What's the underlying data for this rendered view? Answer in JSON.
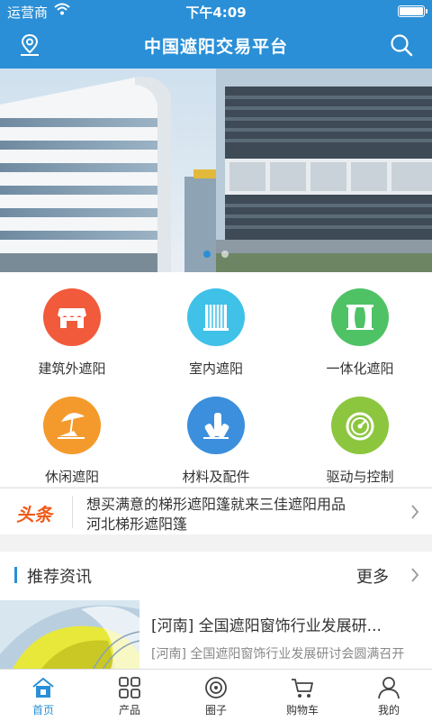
{
  "status_bar": {
    "carrier": "运营商",
    "time": "下午4:09"
  },
  "nav": {
    "title": "中国遮阳交易平台"
  },
  "categories": [
    {
      "label": "建筑外遮阳",
      "color": "#f15a3b",
      "icon": "storefront-icon"
    },
    {
      "label": "室内遮阳",
      "color": "#3fc1e8",
      "icon": "roller-blind-icon"
    },
    {
      "label": "一体化遮阳",
      "color": "#4fc266",
      "icon": "curtain-window-icon"
    },
    {
      "label": "休闲遮阳",
      "color": "#f49a2d",
      "icon": "beach-umbrella-icon"
    },
    {
      "label": "材料及配件",
      "color": "#3b8fdc",
      "icon": "materials-icon"
    },
    {
      "label": "驱动与控制",
      "color": "#8cc63f",
      "icon": "gauge-icon"
    }
  ],
  "headline": {
    "tag": "头条",
    "lines": [
      "想买满意的梯形遮阳篷就来三佳遮阳用品",
      "河北梯形遮阳篷"
    ]
  },
  "news_section": {
    "title": "推荐资讯",
    "more": "更多"
  },
  "news_item": {
    "title": "[河南] 全国遮阳窗饰行业发展研...",
    "summary": "[河南] 全国遮阳窗饰行业发展研讨会圆满召开"
  },
  "tabs": [
    {
      "label": "首页",
      "icon": "home-icon",
      "active": true
    },
    {
      "label": "产品",
      "icon": "grid-icon",
      "active": false
    },
    {
      "label": "圈子",
      "icon": "circle-chat-icon",
      "active": false
    },
    {
      "label": "购物车",
      "icon": "cart-icon",
      "active": false
    },
    {
      "label": "我的",
      "icon": "user-icon",
      "active": false
    }
  ],
  "colors": {
    "primary": "#2a8fd6",
    "headline_tag": "#f05a1a"
  }
}
